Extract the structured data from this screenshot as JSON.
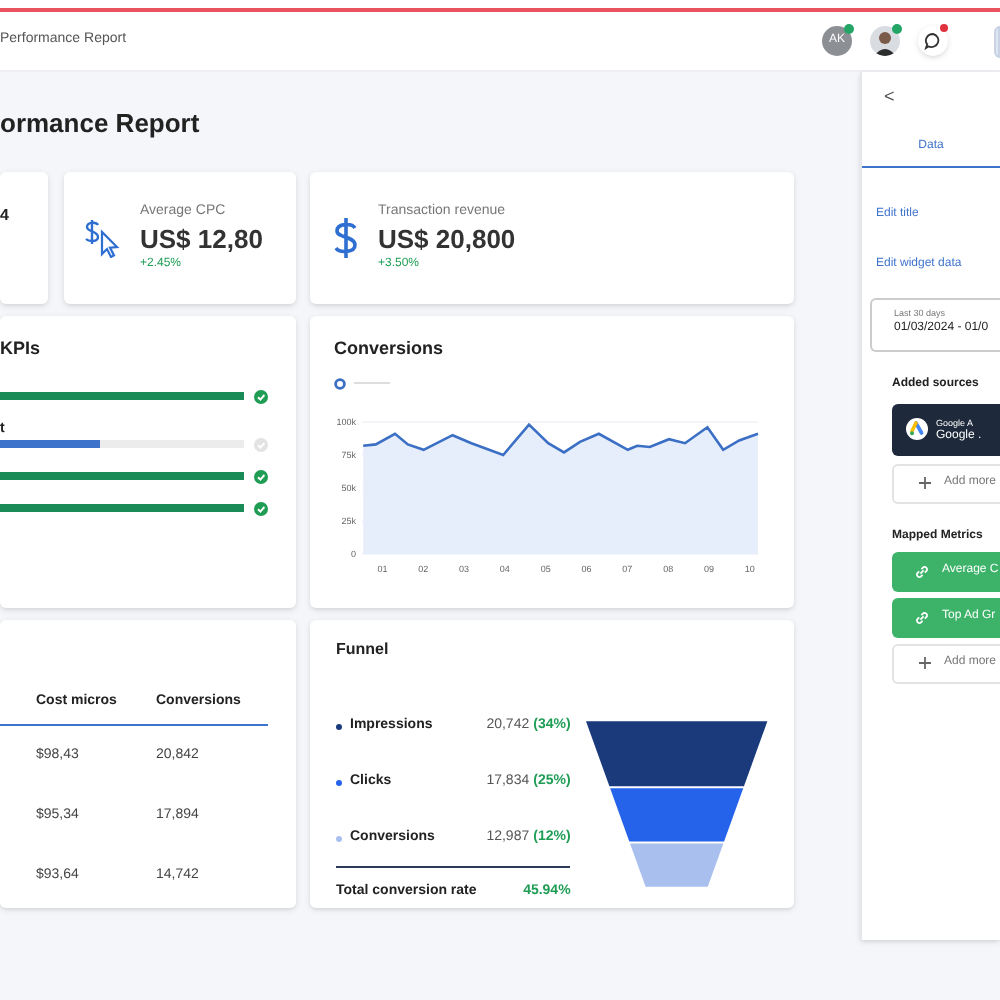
{
  "header": {
    "breadcrumb": "Performance Report",
    "avatars": [
      {
        "kind": "initials",
        "text": "AK",
        "online": true
      },
      {
        "kind": "photo",
        "online": true
      }
    ],
    "chat_unread": true
  },
  "page_title": "ormance Report",
  "stat_cards": [
    {
      "kind": "cut",
      "value": "4"
    },
    {
      "kind": "cpc",
      "label": "Average CPC",
      "value": "US$ 12,80",
      "change": "+2.45%"
    },
    {
      "kind": "dollar",
      "label": "Transaction revenue",
      "value": "US$ 20,800",
      "change": "+3.50%"
    }
  ],
  "kpis": {
    "title": "KPIs",
    "rows": [
      {
        "label": "",
        "level": 1,
        "done": true
      },
      {
        "label": "t",
        "level": 0.41,
        "done": false
      },
      {
        "label": "",
        "level": 1,
        "done": true
      },
      {
        "label": "",
        "level": 1,
        "done": true
      }
    ]
  },
  "conversions": {
    "title": "Conversions",
    "chart_data": {
      "type": "line",
      "x": [
        0.53,
        0.84,
        1.31,
        1.62,
        2.01,
        2.72,
        3.18,
        3.96,
        4.59,
        5.06,
        5.45,
        5.84,
        6.3,
        7.01,
        7.24,
        7.55,
        8.02,
        8.41,
        8.96,
        9.35,
        9.74,
        10.2
      ],
      "series": [
        {
          "color": "#3b6fc4",
          "values": [
            82000,
            83000,
            91000,
            83000,
            79000,
            90000,
            84000,
            75000,
            98000,
            84000,
            77000,
            85000,
            91000,
            79000,
            82000,
            81000,
            87000,
            84000,
            96000,
            79000,
            86000,
            91000
          ]
        }
      ],
      "grid": true,
      "xlim": [
        0.5,
        10.2
      ],
      "ylim": [
        0,
        100000
      ],
      "xticks": [
        {
          "value": 1,
          "label": "01"
        },
        {
          "value": 2,
          "label": "02"
        },
        {
          "value": 3,
          "label": "03"
        },
        {
          "value": 4,
          "label": "04"
        },
        {
          "value": 5,
          "label": "05"
        },
        {
          "value": 6,
          "label": "06"
        },
        {
          "value": 7,
          "label": "07"
        },
        {
          "value": 8,
          "label": "08"
        },
        {
          "value": 9,
          "label": "09"
        },
        {
          "value": 10,
          "label": "10"
        }
      ],
      "yticks": [
        {
          "value": 0,
          "label": "0"
        },
        {
          "value": 25000,
          "label": "25k"
        },
        {
          "value": 50000,
          "label": "50k"
        },
        {
          "value": 75000,
          "label": "75k"
        },
        {
          "value": 100000,
          "label": "100k"
        }
      ]
    }
  },
  "table": {
    "columns": [
      "Cost micros",
      "Conversions"
    ],
    "rows": [
      [
        "$98,43",
        "20,842"
      ],
      [
        "$95,34",
        "17,894"
      ],
      [
        "$93,64",
        "14,742"
      ]
    ]
  },
  "funnel": {
    "title": "Funnel",
    "stages": [
      {
        "label": "Impressions",
        "value": "20,742",
        "percent": "(34%)",
        "color": "#1a3a7c"
      },
      {
        "label": "Clicks",
        "value": "17,834",
        "percent": "(25%)",
        "color": "#2563eb"
      },
      {
        "label": "Conversions",
        "value": "12,987",
        "percent": "(12%)",
        "color": "#a9c0ef"
      }
    ],
    "total_label": "Total conversion rate",
    "total_value": "45.94%"
  },
  "panel": {
    "back": "<",
    "tabs": [
      {
        "label": "Data",
        "selected": true
      }
    ],
    "links": [
      "Edit title",
      "Edit widget data"
    ],
    "date_range": {
      "label": "Last 30 days",
      "value": "01/03/2024 - 01/0"
    },
    "sources_title": "Added sources",
    "sources": [
      {
        "name": "Google A",
        "account": "Google ."
      }
    ],
    "add_source": "Add more",
    "metrics_title": "Mapped Metrics",
    "metrics": [
      "Average C",
      "Top Ad Gr"
    ],
    "add_metric": "Add more"
  }
}
